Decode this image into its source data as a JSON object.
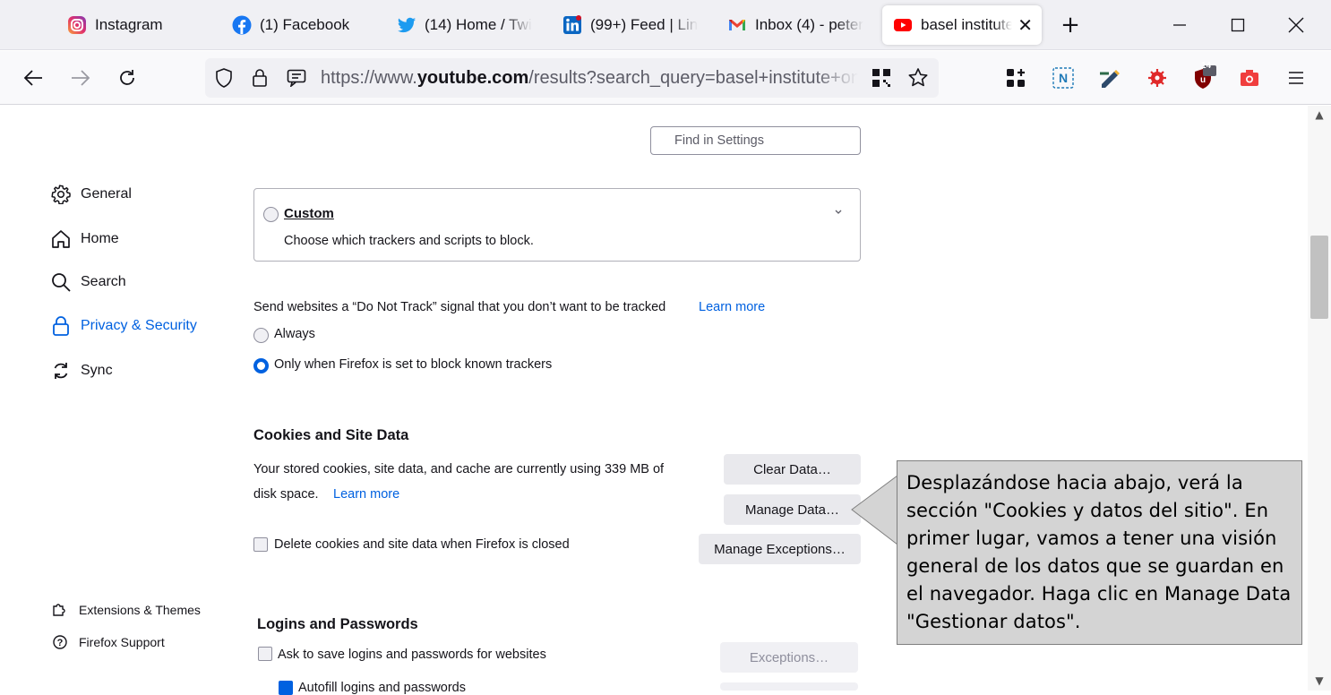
{
  "tabs": [
    {
      "label": "Instagram",
      "icon": "instagram-icon"
    },
    {
      "label": "(1) Facebook",
      "icon": "facebook-icon"
    },
    {
      "label": "(14) Home / Twi",
      "icon": "twitter-icon"
    },
    {
      "label": "(99+) Feed | Lin",
      "icon": "linkedin-icon"
    },
    {
      "label": "Inbox (4) - peter",
      "icon": "gmail-icon"
    },
    {
      "label": "basel institute",
      "icon": "youtube-icon",
      "active": true
    }
  ],
  "new_tab": "+",
  "url": {
    "prefix": "https://www.",
    "domain": "youtube.com",
    "suffix": "/results?search_query=basel+institute+on"
  },
  "extensions": {
    "badge_count": "14"
  },
  "search": {
    "placeholder": "Find in Settings"
  },
  "sidebar": {
    "items": [
      {
        "label": "General",
        "icon": "gear-icon"
      },
      {
        "label": "Home",
        "icon": "home-icon"
      },
      {
        "label": "Search",
        "icon": "search-icon"
      },
      {
        "label": "Privacy & Security",
        "icon": "lock-icon",
        "selected": true
      },
      {
        "label": "Sync",
        "icon": "sync-icon"
      }
    ],
    "footer": [
      {
        "label": "Extensions & Themes",
        "icon": "puzzle-icon"
      },
      {
        "label": "Firefox Support",
        "icon": "help-icon"
      }
    ]
  },
  "custom": {
    "title": "Custom",
    "description": "Choose which trackers and scripts to block."
  },
  "dnt": {
    "label": "Send websites a “Do Not Track” signal that you don’t want to be tracked",
    "learn_more": "Learn more",
    "options": [
      {
        "label": "Always",
        "selected": false
      },
      {
        "label": "Only when Firefox is set to block known trackers",
        "selected": true
      }
    ]
  },
  "cookies": {
    "heading": "Cookies and Site Data",
    "desc_line1": "Your stored cookies, site data, and cache are currently using 339 MB of",
    "desc_line2": "disk space.",
    "learn_more": "Learn more",
    "clear_button": "Clear Data…",
    "manage_button": "Manage Data…",
    "exceptions_button": "Manage Exceptions…",
    "delete_on_close": "Delete cookies and site data when Firefox is closed"
  },
  "logins": {
    "heading": "Logins and Passwords",
    "ask_to_save": "Ask to save logins and passwords for websites",
    "autofill": "Autofill logins and passwords",
    "exceptions_button": "Exceptions…"
  },
  "callout": {
    "text": "Desplazándose hacia abajo, verá la sección \"Cookies y datos del sitio\". En primer lugar, vamos a tener una visión general de los datos que se guardan en el navegador. Haga clic en Manage Data \"Gestionar datos\"."
  },
  "colors": {
    "accent": "#0061e0",
    "callout_bg": "#d4d4d4"
  }
}
